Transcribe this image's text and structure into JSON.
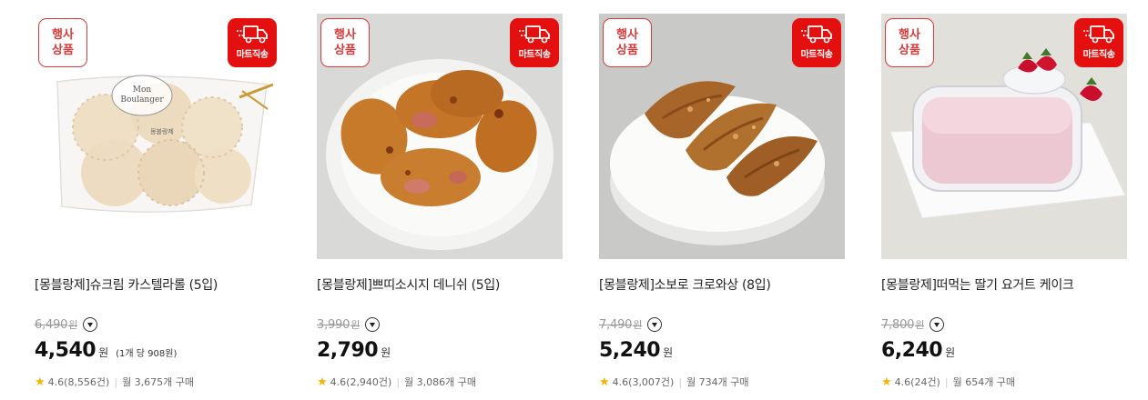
{
  "badges": {
    "event_line1": "행사",
    "event_line2": "상품",
    "mart": "마트직송"
  },
  "products": [
    {
      "title": "[몽블랑제]슈크림 카스텔라롤 (5입)",
      "original_price": "6,490",
      "price": "4,540",
      "currency": "원",
      "unit_price": "(1개 당 908원)",
      "rating": "4.6(8,556건)",
      "monthly": "월 3,675개 구매"
    },
    {
      "title": "[몽블랑제]쁘띠소시지 데니쉬 (5입)",
      "original_price": "3,990",
      "price": "2,790",
      "currency": "원",
      "unit_price": "",
      "rating": "4.6(2,940건)",
      "monthly": "월 3,086개 구매"
    },
    {
      "title": "[몽블랑제]소보로 크로와상 (8입)",
      "original_price": "7,490",
      "price": "5,240",
      "currency": "원",
      "unit_price": "",
      "rating": "4.6(3,007건)",
      "monthly": "월 734개 구매"
    },
    {
      "title": "[몽블랑제]떠먹는 딸기 요거트 케이크",
      "original_price": "7,800",
      "price": "6,240",
      "currency": "원",
      "unit_price": "",
      "rating": "4.6(24건)",
      "monthly": "월 654개 구매"
    }
  ],
  "bag_text": {
    "line1": "Mon",
    "line2": "Boulanger",
    "sticker": "몽블랑제"
  },
  "colors": {
    "badge_red": "#e3100f",
    "badge_border": "#d63a3a",
    "star": "#f5b400"
  }
}
